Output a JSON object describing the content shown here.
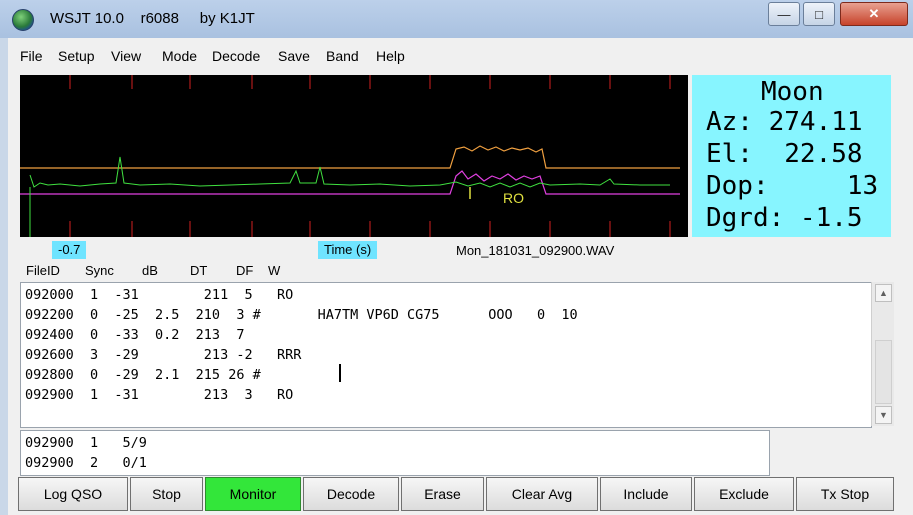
{
  "window": {
    "title": "WSJT 10.0    r6088     by K1JT"
  },
  "menu": [
    "File",
    "Setup",
    "View",
    "Mode",
    "Decode",
    "Save",
    "Band",
    "Help"
  ],
  "moon": {
    "title": "Moon",
    "az": "Az: 274.11",
    "el": "El:  22.58",
    "dop": "Dop:     13",
    "dgrd": "Dgrd: -1.5"
  },
  "spectrum": {
    "marker_label": "RO",
    "colors": {
      "orange": "#f0a040",
      "magenta": "#e040e0",
      "green": "#40e040",
      "tick": "#d02020"
    }
  },
  "status": {
    "left_value": "-0.7",
    "time_label": "Time (s)",
    "filename": "Mon_181031_092900.WAV"
  },
  "columns": [
    "FileID",
    "Sync",
    "dB",
    "DT",
    "DF",
    "W"
  ],
  "decodes": [
    "092000  1  -31        211  5   RO",
    "092200  0  -25  2.5  210  3 #       HA7TM VP6D CG75      OOO   0  10",
    "092400  0  -33  0.2  213  7",
    "092600  3  -29        213 -2   RRR",
    "092800  0  -29  2.1  215 26 #",
    "092900  1  -31        213  3   RO"
  ],
  "averages": [
    "092900  1   5/9",
    "092900  2   0/1"
  ],
  "buttons": [
    {
      "label": "Log QSO",
      "active": false
    },
    {
      "label": "Stop",
      "active": false
    },
    {
      "label": "Monitor",
      "active": true
    },
    {
      "label": "Decode",
      "active": false
    },
    {
      "label": "Erase",
      "active": false
    },
    {
      "label": "Clear Avg",
      "active": false
    },
    {
      "label": "Include",
      "active": false
    },
    {
      "label": "Exclude",
      "active": false
    },
    {
      "label": "Tx Stop",
      "active": false
    }
  ]
}
